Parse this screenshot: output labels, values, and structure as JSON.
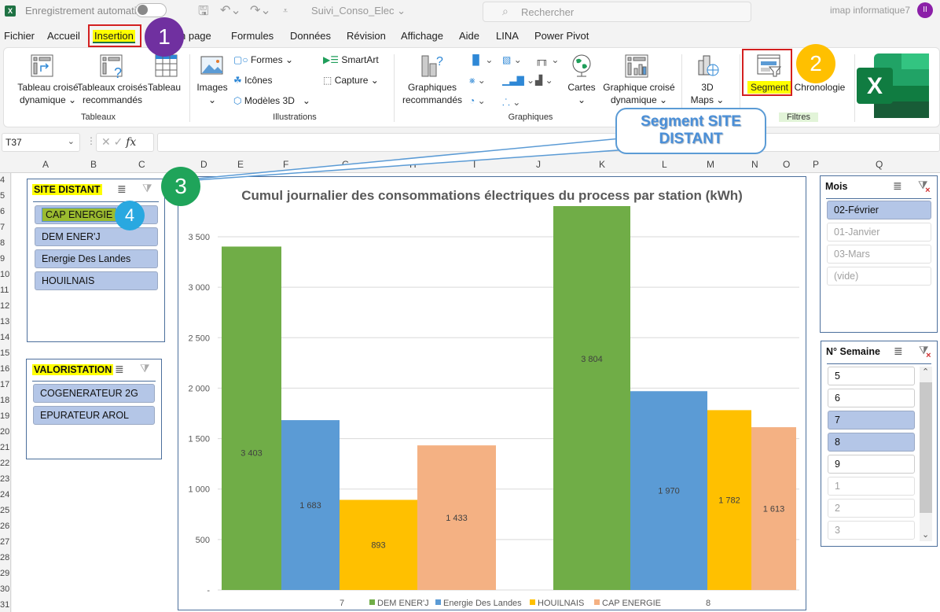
{
  "titlebar": {
    "autosave_label": "Enregistrement automatique",
    "doc_title": "Suivi_Conso_Elec",
    "search_placeholder": "Rechercher",
    "user_name": "imap informatique7",
    "avatar_initials": "II"
  },
  "menu": {
    "items": [
      "Fichier",
      "Accueil",
      "Insertion",
      "Mise en page",
      "Formules",
      "Données",
      "Révision",
      "Affichage",
      "Aide",
      "LINA",
      "Power Pivot"
    ],
    "visible_partial_mise": "n page",
    "active": "Insertion"
  },
  "ribbon": {
    "tableaux": {
      "group_label": "Tableaux",
      "pivot_table_l1": "Tableau croisé",
      "pivot_table_l2": "dynamique",
      "rec_pivot_l1": "Tableaux croisés",
      "rec_pivot_l2": "recommandés",
      "table": "Tableau"
    },
    "illustrations": {
      "group_label": "Illustrations",
      "images": "Images",
      "shapes": "Formes",
      "icons": "Icônes",
      "models3d": "Modèles 3D",
      "smartart": "SmartArt",
      "capture": "Capture"
    },
    "graphiques": {
      "group_label": "Graphiques",
      "rec_charts_l1": "Graphiques",
      "rec_charts_l2": "recommandés",
      "maps": "Cartes",
      "pivot_chart_l1": "Graphique croisé",
      "pivot_chart_l2": "dynamique"
    },
    "tours": {
      "maps3d_l1": "3D",
      "maps3d_l2": "Maps"
    },
    "filtres": {
      "group_label": "Filtres",
      "slicer": "Segment",
      "timeline": "Chronologie"
    }
  },
  "formula_bar": {
    "name_box": "T37",
    "formula": ""
  },
  "columns": [
    "A",
    "B",
    "C",
    "D",
    "E",
    "F",
    "G",
    "H",
    "I",
    "J",
    "K",
    "L",
    "M",
    "N",
    "O",
    "P",
    "Q"
  ],
  "rows": [
    "4",
    "5",
    "6",
    "7",
    "8",
    "9",
    "10",
    "11",
    "12",
    "13",
    "14",
    "15",
    "16",
    "17",
    "18",
    "19",
    "20",
    "21",
    "22",
    "23",
    "24",
    "25",
    "26",
    "27",
    "28",
    "29",
    "30",
    "31"
  ],
  "annotations": {
    "badge1": "1",
    "badge2": "2",
    "badge3": "3",
    "badge4": "4",
    "callout_l1": "Segment SITE",
    "callout_l2": "DISTANT"
  },
  "slicers": {
    "site": {
      "title": "SITE DISTANT",
      "items": [
        {
          "label": "CAP ENERGIE",
          "state": "selected"
        },
        {
          "label": "DEM ENER'J",
          "state": "selected"
        },
        {
          "label": "Energie Des Landes",
          "state": "selected"
        },
        {
          "label": "HOUILNAIS",
          "state": "selected"
        }
      ]
    },
    "valo": {
      "title": "VALORISTATION",
      "items": [
        {
          "label": "COGENERATEUR 2G",
          "state": "selected"
        },
        {
          "label": "EPURATEUR AROL",
          "state": "selected"
        }
      ]
    },
    "mois": {
      "title": "Mois",
      "items": [
        {
          "label": "02-Février",
          "state": "selected"
        },
        {
          "label": "01-Janvier",
          "state": "nodata"
        },
        {
          "label": "03-Mars",
          "state": "nodata"
        },
        {
          "label": "(vide)",
          "state": "nodata"
        }
      ]
    },
    "semaine": {
      "title": "N° Semaine",
      "items": [
        {
          "label": "5",
          "state": "unselected"
        },
        {
          "label": "6",
          "state": "unselected"
        },
        {
          "label": "7",
          "state": "selected"
        },
        {
          "label": "8",
          "state": "selected"
        },
        {
          "label": "9",
          "state": "unselected"
        },
        {
          "label": "1",
          "state": "nodata"
        },
        {
          "label": "2",
          "state": "nodata"
        },
        {
          "label": "3",
          "state": "nodata"
        }
      ]
    }
  },
  "colors": {
    "DEM ENER'J": "#70ad47",
    "Energie Des Landes": "#5b9bd5",
    "HOUILNAIS": "#ffc000",
    "CAP ENERGIE": "#f4b183"
  },
  "chart_data": {
    "type": "bar",
    "title": "Cumul journalier des consommations électriques du process par station (kWh)",
    "categories": [
      "7",
      "8"
    ],
    "series": [
      {
        "name": "DEM ENER'J",
        "values": [
          3403,
          3804
        ],
        "labels": [
          "3 403",
          "3 804"
        ]
      },
      {
        "name": "Energie Des Landes",
        "values": [
          1683,
          1970
        ],
        "labels": [
          "1 683",
          "1 970"
        ]
      },
      {
        "name": "HOUILNAIS",
        "values": [
          893,
          1782
        ],
        "labels": [
          "893",
          "1 782"
        ]
      },
      {
        "name": "CAP ENERGIE",
        "values": [
          1433,
          1613
        ],
        "labels": [
          "1 433",
          "1 613"
        ]
      }
    ],
    "ylim": [
      0,
      3500
    ],
    "yticks": [
      0,
      500,
      1000,
      1500,
      2000,
      2500,
      3000,
      3500
    ],
    "ytick_labels": [
      "-",
      "500",
      "1 000",
      "1 500",
      "2 000",
      "2 500",
      "3 000",
      "3 500"
    ],
    "xlabel": "",
    "ylabel": "",
    "grid": true,
    "legend": "bottom"
  }
}
